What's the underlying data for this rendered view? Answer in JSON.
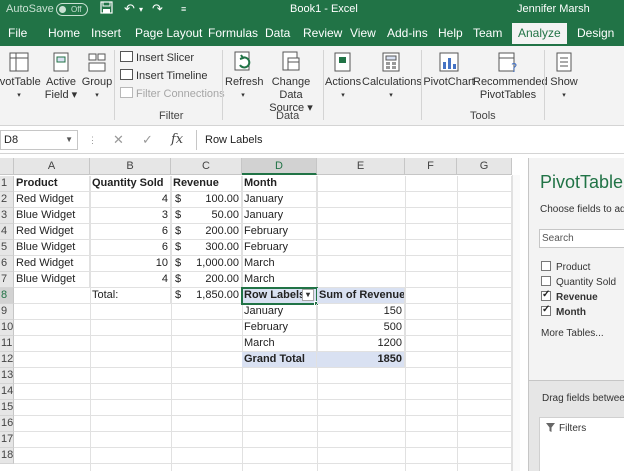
{
  "titlebar": {
    "autosave_label": "AutoSave",
    "autosave_state": "Off",
    "doc_title": "Book1 - Excel",
    "user_name": "Jennifer Marsh"
  },
  "tabs": [
    "File",
    "Home",
    "Insert",
    "Page Layout",
    "Formulas",
    "Data",
    "Review",
    "View",
    "Add-ins",
    "Help",
    "Team",
    "Analyze",
    "Design"
  ],
  "ribbon": {
    "pivottable": [
      "ivotTable",
      "▾"
    ],
    "active_field": [
      "Active",
      "Field ▾"
    ],
    "group": [
      "Group",
      "▾"
    ],
    "insert_slicer": "Insert Slicer",
    "insert_timeline": "Insert Timeline",
    "filter_connections": "Filter Connections",
    "filter_group": "Filter",
    "refresh": [
      "Refresh",
      "▾"
    ],
    "change_data_source": [
      "Change Data",
      "Source ▾"
    ],
    "data_group": "Data",
    "actions": [
      "Actions",
      "▾"
    ],
    "calculations": [
      "Calculations",
      "▾"
    ],
    "pivotchart": "PivotChart",
    "recommended": [
      "Recommended",
      "PivotTables"
    ],
    "tools_group": "Tools",
    "show": [
      "Show",
      "▾"
    ]
  },
  "formula_bar": {
    "name_box": "D8",
    "cancel": "✕",
    "enter": "✓",
    "fx": "fx",
    "value": "Row Labels"
  },
  "columns": [
    "A",
    "B",
    "C",
    "D",
    "E",
    "F",
    "G"
  ],
  "rows": [
    "1",
    "2",
    "3",
    "4",
    "5",
    "6",
    "7",
    "8",
    "9",
    "10",
    "11",
    "12",
    "13",
    "14",
    "15",
    "16",
    "17",
    "18"
  ],
  "sheet": {
    "headers": [
      "Product",
      "Quantity Sold",
      "Revenue",
      "Month"
    ],
    "data": [
      {
        "product": "Red Widget",
        "qty": "4",
        "rev": "100.00",
        "month": "January"
      },
      {
        "product": "Blue Widget",
        "qty": "3",
        "rev": "50.00",
        "month": "January"
      },
      {
        "product": "Red Widget",
        "qty": "6",
        "rev": "200.00",
        "month": "February"
      },
      {
        "product": "Blue Widget",
        "qty": "6",
        "rev": "300.00",
        "month": "February"
      },
      {
        "product": "Red Widget",
        "qty": "10",
        "rev": "1,000.00",
        "month": "March"
      },
      {
        "product": "Blue Widget",
        "qty": "4",
        "rev": "200.00",
        "month": "March"
      }
    ],
    "currency": "$",
    "total_label": "Total:",
    "total_value": "1,850.00"
  },
  "pivot": {
    "row_labels": "Row Labels",
    "filter_icon": "▾",
    "sum_label": "Sum of Revenue",
    "rows": [
      {
        "label": "January",
        "value": "150"
      },
      {
        "label": "February",
        "value": "500"
      },
      {
        "label": "March",
        "value": "1200"
      }
    ],
    "grand_total_label": "Grand Total",
    "grand_total_value": "1850"
  },
  "pane": {
    "title": "PivotTable",
    "subtitle": "Choose fields to ad",
    "search": "Search",
    "fields": [
      {
        "name": "Product",
        "checked": false
      },
      {
        "name": "Quantity Sold",
        "checked": false
      },
      {
        "name": "Revenue",
        "checked": true
      },
      {
        "name": "Month",
        "checked": true
      }
    ],
    "more_tables": "More Tables...",
    "drag_text": "Drag fields between",
    "filters": "Filters"
  },
  "colors": {
    "excel_green": "#217346",
    "pivot_blue": "#d9e1f2"
  }
}
